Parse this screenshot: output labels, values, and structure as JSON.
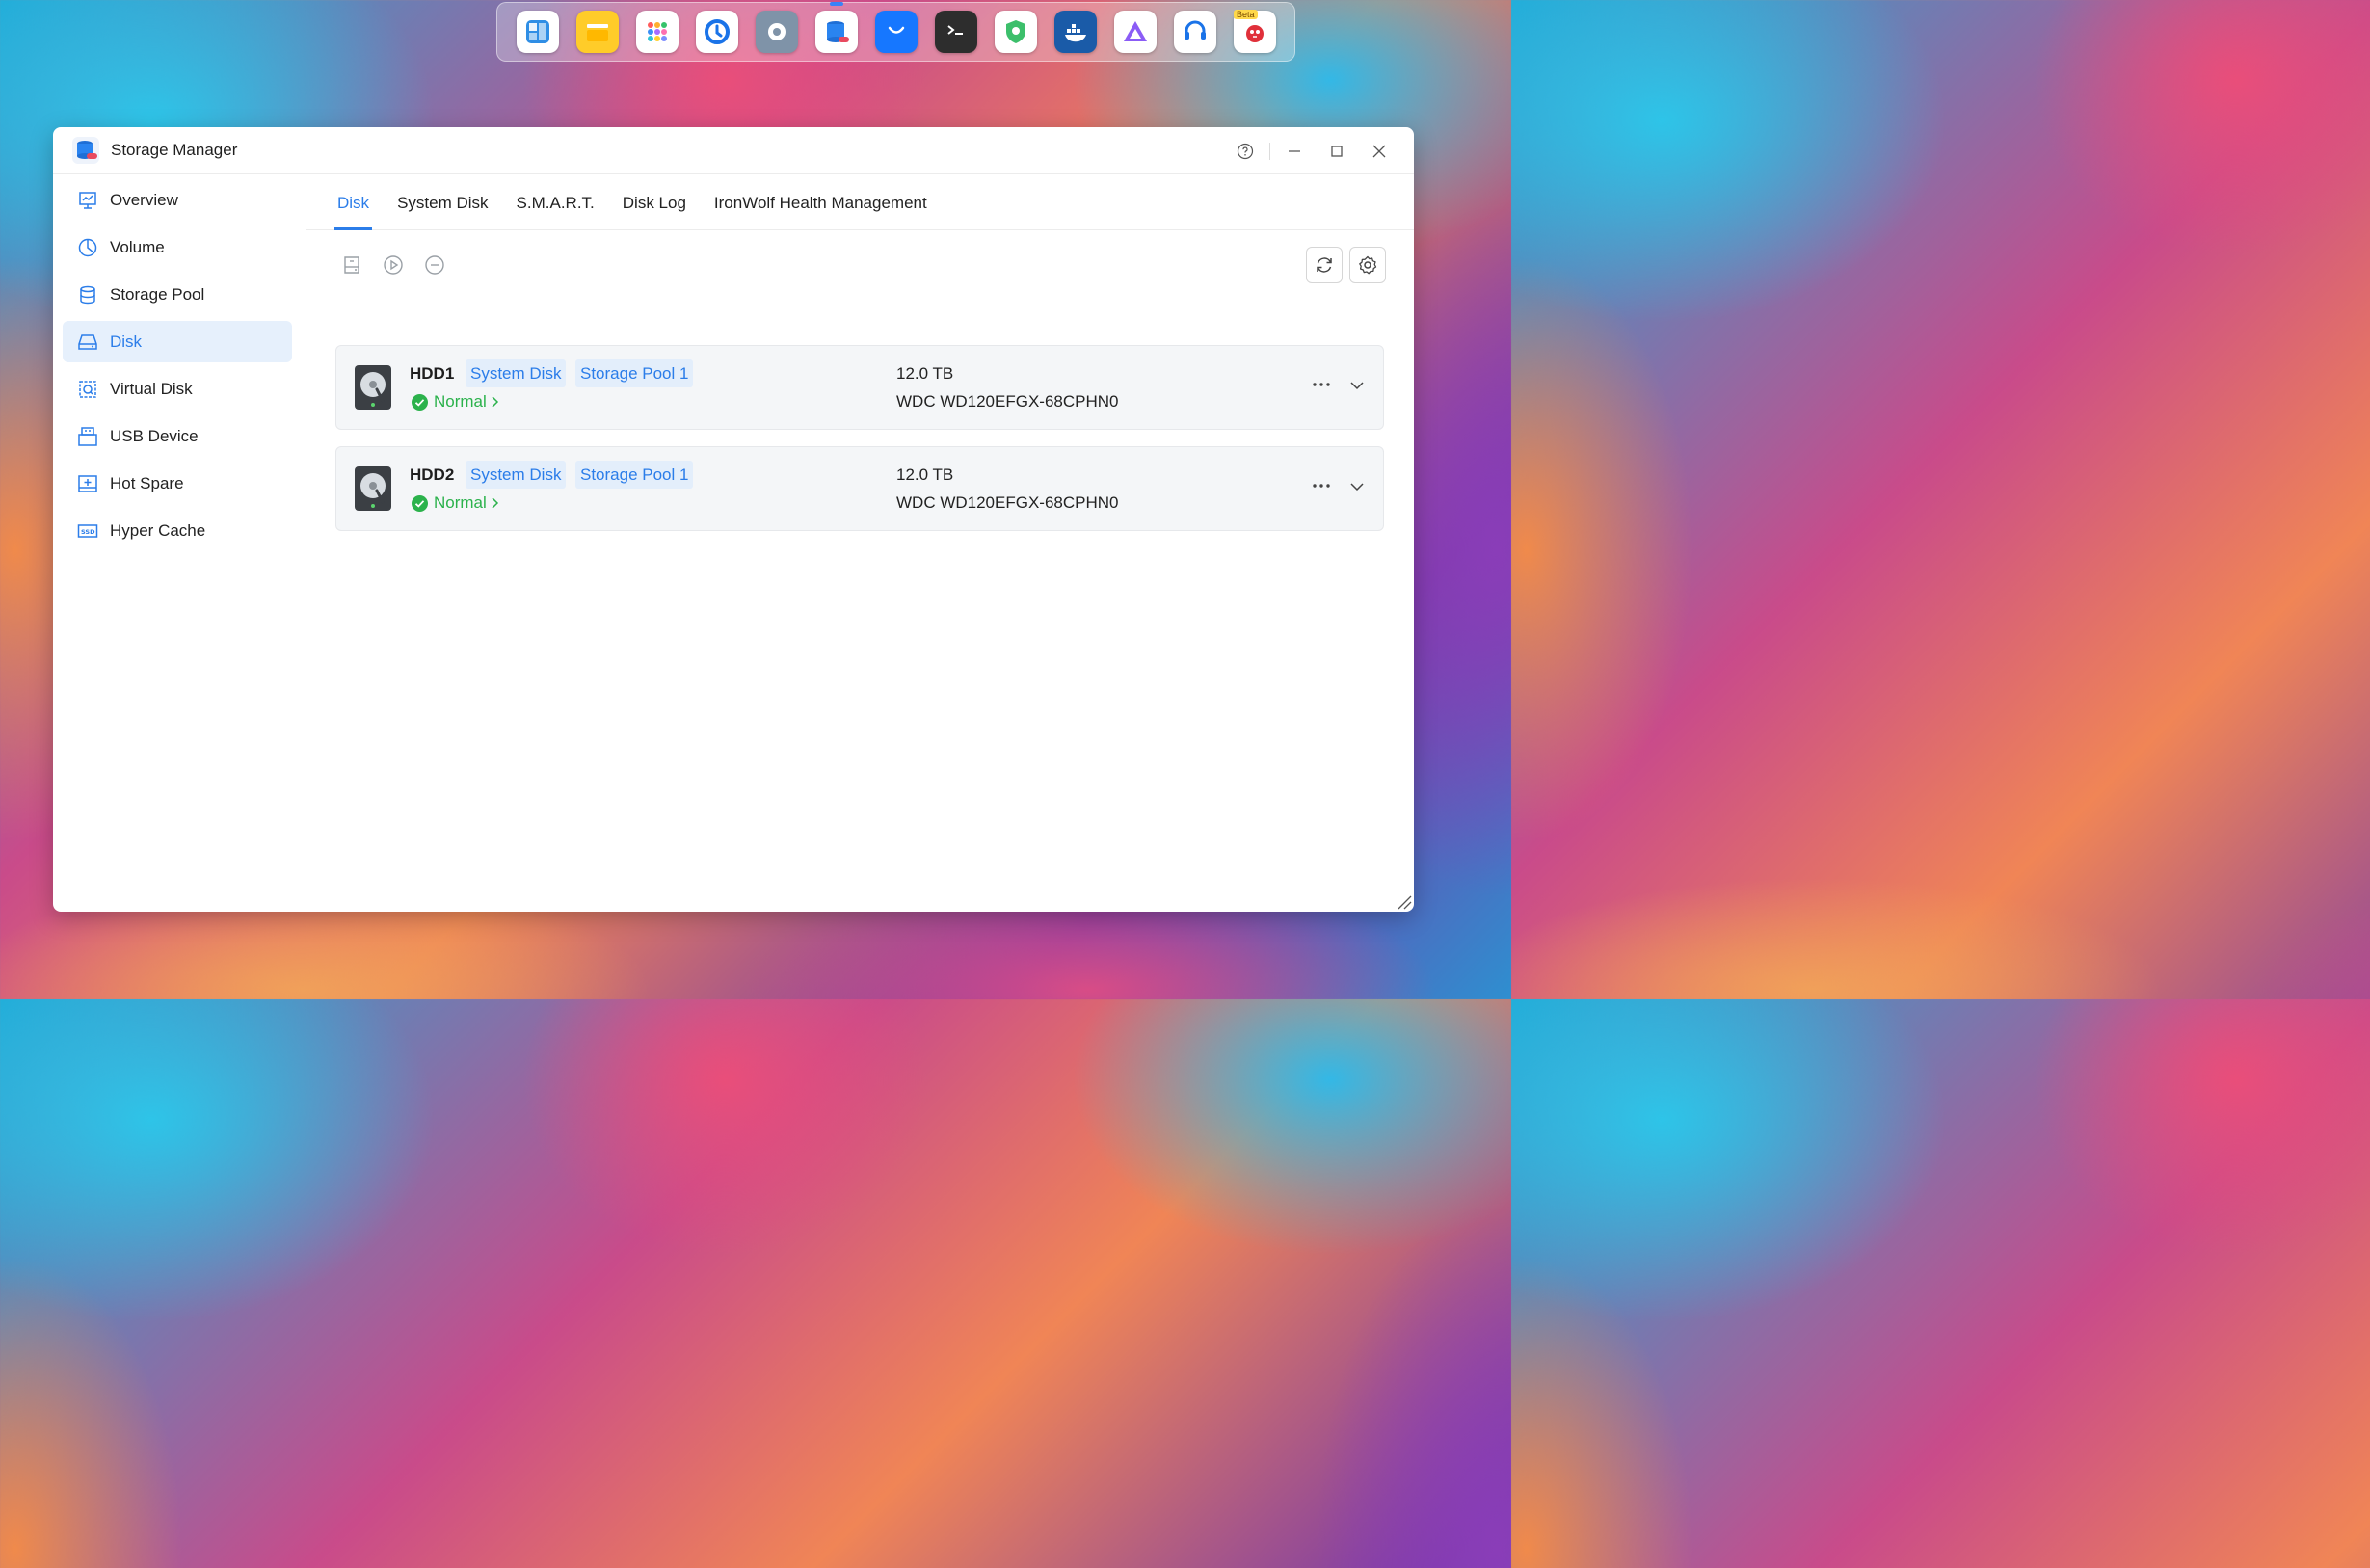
{
  "dock": {
    "apps": [
      {
        "name": "app-center-icon",
        "bg": "#ffffff"
      },
      {
        "name": "file-manager-icon",
        "bg": "#ffcc29"
      },
      {
        "name": "app-launcher-icon",
        "bg": "#ffffff"
      },
      {
        "name": "backup-icon",
        "bg": "#ffffff"
      },
      {
        "name": "control-panel-icon",
        "bg": "#7f93a8"
      },
      {
        "name": "storage-manager-icon",
        "bg": "#ffffff"
      },
      {
        "name": "app-store-icon",
        "bg": "#1677ff"
      },
      {
        "name": "terminal-icon",
        "bg": "#2d2d2d"
      },
      {
        "name": "security-icon",
        "bg": "#ffffff"
      },
      {
        "name": "docker-icon",
        "bg": "#1a5ba8"
      },
      {
        "name": "jellyfin-icon",
        "bg": "#ffffff"
      },
      {
        "name": "support-icon",
        "bg": "#ffffff"
      },
      {
        "name": "beta-app-icon",
        "bg": "#ffffff"
      }
    ],
    "beta_label": "Beta"
  },
  "window": {
    "title": "Storage Manager"
  },
  "sidebar": {
    "items": [
      {
        "label": "Overview",
        "icon": "overview-icon",
        "active": false
      },
      {
        "label": "Volume",
        "icon": "volume-icon",
        "active": false
      },
      {
        "label": "Storage Pool",
        "icon": "storage-pool-icon",
        "active": false
      },
      {
        "label": "Disk",
        "icon": "disk-icon",
        "active": true
      },
      {
        "label": "Virtual Disk",
        "icon": "virtual-disk-icon",
        "active": false
      },
      {
        "label": "USB Device",
        "icon": "usb-icon",
        "active": false
      },
      {
        "label": "Hot Spare",
        "icon": "hot-spare-icon",
        "active": false
      },
      {
        "label": "Hyper Cache",
        "icon": "ssd-cache-icon",
        "active": false
      }
    ]
  },
  "tabs": [
    {
      "label": "Disk",
      "active": true
    },
    {
      "label": "System Disk",
      "active": false
    },
    {
      "label": "S.M.A.R.T.",
      "active": false
    },
    {
      "label": "Disk Log",
      "active": false
    },
    {
      "label": "IronWolf Health Management",
      "active": false
    }
  ],
  "disks": [
    {
      "name": "HDD1",
      "tags": [
        "System Disk",
        "Storage Pool 1"
      ],
      "status": "Normal",
      "size": "12.0 TB",
      "model": "WDC WD120EFGX-68CPHN0"
    },
    {
      "name": "HDD2",
      "tags": [
        "System Disk",
        "Storage Pool 1"
      ],
      "status": "Normal",
      "size": "12.0 TB",
      "model": "WDC WD120EFGX-68CPHN0"
    }
  ],
  "colors": {
    "accent": "#2b7de9",
    "status_ok": "#2bb24c",
    "active_nav_bg": "#e6f0fc"
  }
}
